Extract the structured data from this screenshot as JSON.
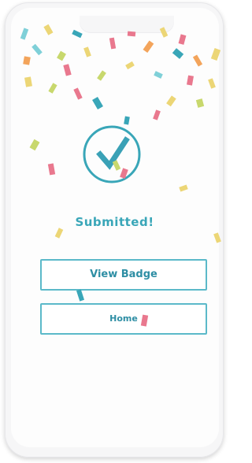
{
  "colors": {
    "accent": "#39a6b8",
    "accent_dark": "#2e8ea4",
    "confetti": [
      "#7fd0d8",
      "#e9788e",
      "#ecd676",
      "#c8d86d",
      "#f3a45b"
    ]
  },
  "screen": {
    "status_icon": "checkmark-circle-icon",
    "title": "Submitted!"
  },
  "actions": {
    "view_badge_label": "View Badge",
    "home_label": "Home"
  }
}
